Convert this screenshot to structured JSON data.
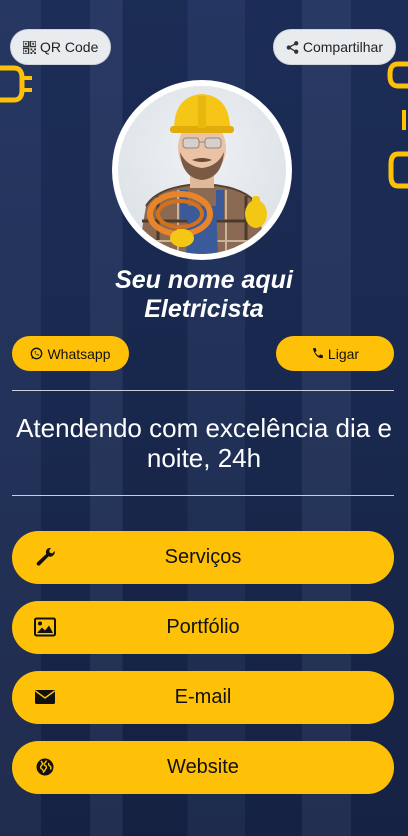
{
  "header": {
    "qr_label": "QR Code",
    "share_label": "Compartilhar"
  },
  "profile": {
    "name": "Seu nome aqui",
    "role": "Eletricista"
  },
  "contact": {
    "whatsapp_label": "Whatsapp",
    "call_label": "Ligar"
  },
  "tagline": "Atendendo com excelência dia e noite, 24h",
  "menu": [
    {
      "label": "Serviços",
      "icon": "wrench-icon"
    },
    {
      "label": "Portfólio",
      "icon": "image-icon"
    },
    {
      "label": "E-mail",
      "icon": "envelope-icon"
    },
    {
      "label": "Website",
      "icon": "globe-icon"
    }
  ],
  "colors": {
    "background": "#1b2a52",
    "accent": "#ffc107",
    "text_light": "#ffffff"
  }
}
